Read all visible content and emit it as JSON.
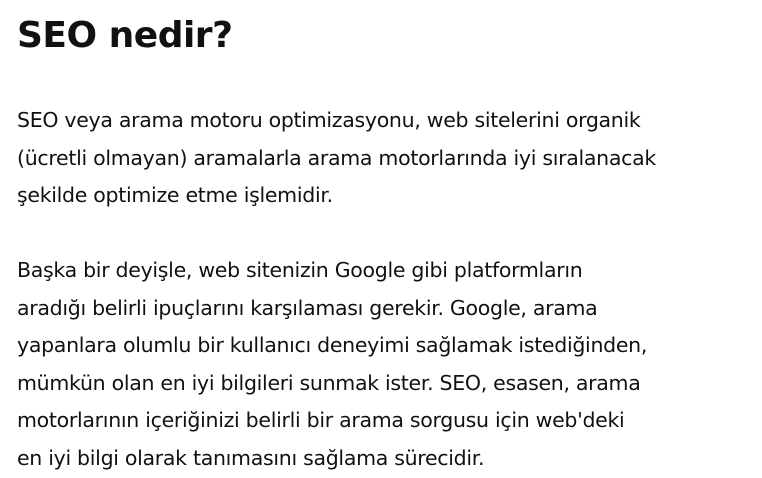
{
  "article": {
    "title": "SEO nedir?",
    "paragraphs": [
      {
        "lines": [
          "SEO veya arama motoru optimizasyonu, web sitelerini organik",
          "(ücretli olmayan) aramalarla arama motorlarında iyi sıralanacak",
          "şekilde optimize etme işlemidir."
        ]
      },
      {
        "lines": [
          "Başka bir deyişle, web sitenizin Google gibi platformların",
          "aradığı belirli ipuçlarını karşılaması gerekir. Google, arama",
          "yapanlara olumlu bir kullanıcı deneyimi sağlamak istediğinden,",
          "mümkün olan en iyi bilgileri sunmak ister. SEO, esasen, arama",
          "motorlarının içeriğinizi belirli bir arama sorgusu için web'deki",
          "en iyi bilgi olarak tanımasını sağlama sürecidir."
        ]
      }
    ]
  }
}
